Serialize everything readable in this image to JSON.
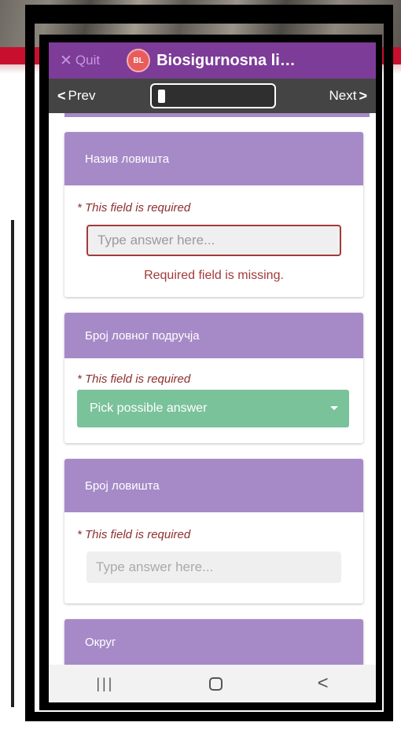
{
  "app_bar": {
    "quit_label": "Quit",
    "logo_text": "BL",
    "title": "Biosigurnosna li…"
  },
  "nav": {
    "prev_label": "Prev",
    "next_label": "Next"
  },
  "questions": [
    {
      "title": "Назив ловишта",
      "required_text": "* This field is required",
      "placeholder": "Type answer here...",
      "error_text": "Required field is missing."
    },
    {
      "title": "Број ловног подручја",
      "required_text": "* This field is required",
      "select_label": "Pick possible answer"
    },
    {
      "title": "Број ловишта",
      "required_text": "* This field is required",
      "placeholder": "Type answer here..."
    },
    {
      "title": "Округ"
    }
  ],
  "colors": {
    "app_bar": "#7d3c98",
    "nav_bar": "#444444",
    "card_header": "#a68ac7",
    "select": "#7ac29a",
    "error": "#a33a3a"
  },
  "icons": {
    "quit": "close-icon",
    "prev": "chevron-left-icon",
    "next": "chevron-right-icon",
    "select": "caret-down-icon",
    "recent": "recent-apps-icon",
    "home": "home-icon",
    "back": "back-icon"
  }
}
